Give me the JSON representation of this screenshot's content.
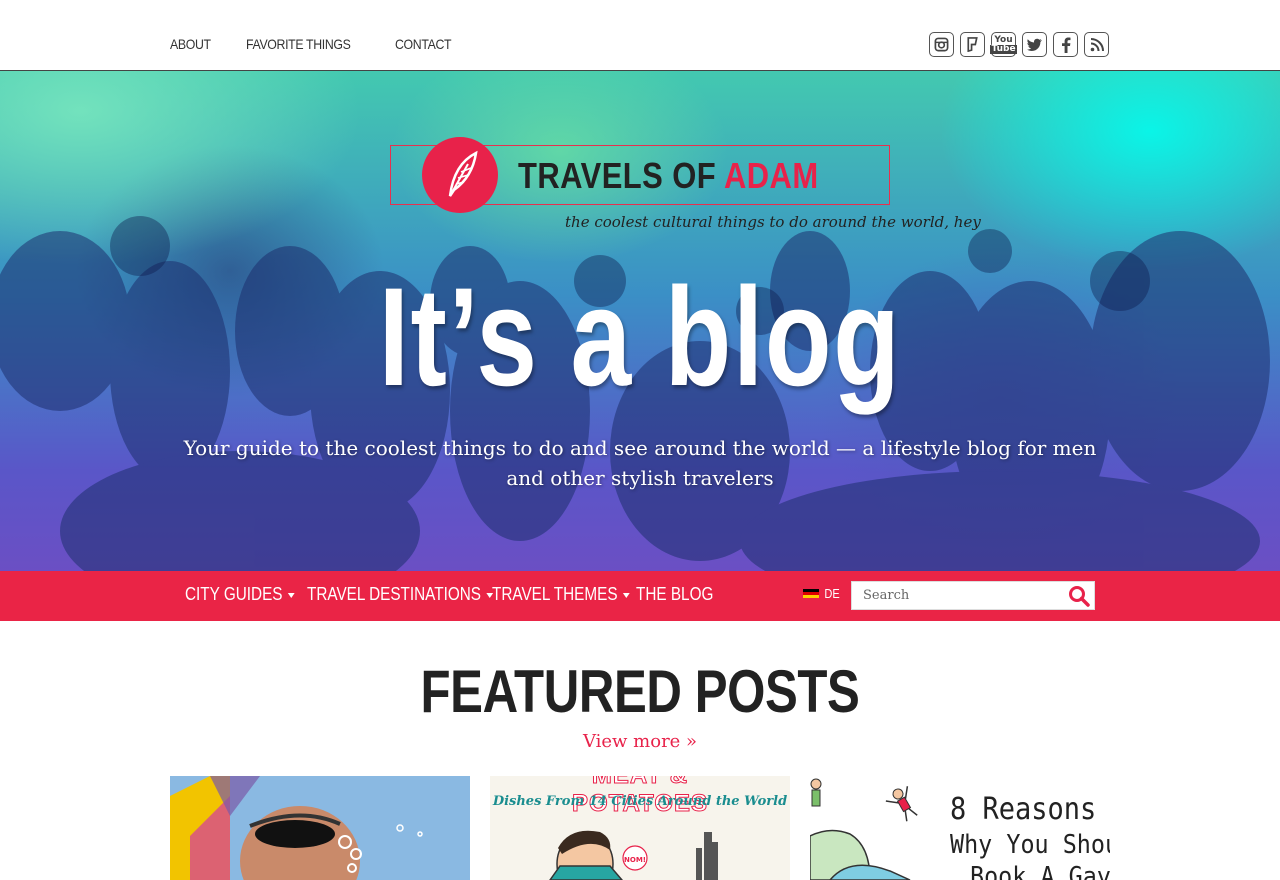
{
  "top_nav": {
    "items": [
      "ABOUT",
      "FAVORITE THINGS",
      "CONTACT"
    ]
  },
  "social": {
    "icons": [
      "instagram-icon",
      "foursquare-icon",
      "youtube-icon",
      "twitter-icon",
      "facebook-icon",
      "rss-icon"
    ]
  },
  "hero": {
    "logo_text_a": "TRAVELS OF ",
    "logo_text_b": "ADAM",
    "tagline": "the coolest cultural things to do around the world, hey",
    "headline": "It’s a blog",
    "subhead": "Your guide to the coolest things to do and see around the world — a lifestyle blog for men and other stylish travelers"
  },
  "main_nav": {
    "items": [
      {
        "label": "CITY GUIDES",
        "dropdown": true
      },
      {
        "label": "TRAVEL DESTINATIONS",
        "dropdown": true
      },
      {
        "label": "TRAVEL THEMES",
        "dropdown": true
      },
      {
        "label": "THE BLOG",
        "dropdown": false
      }
    ],
    "language": "DE",
    "search_placeholder": "Search"
  },
  "featured": {
    "title": "FEATURED POSTS",
    "view_more": "View more »",
    "card2_title": "MEAT & POTATOES",
    "card2_sub": "Dishes From 14 Cities Around the World",
    "card2_bubble": "NOM!",
    "card3_text_1": "8 Reasons",
    "card3_text_2": "Why You Shou",
    "card3_text_3": "Book A Gay"
  },
  "colors": {
    "brand_red": "#ea2446",
    "text_dark": "#222222"
  }
}
